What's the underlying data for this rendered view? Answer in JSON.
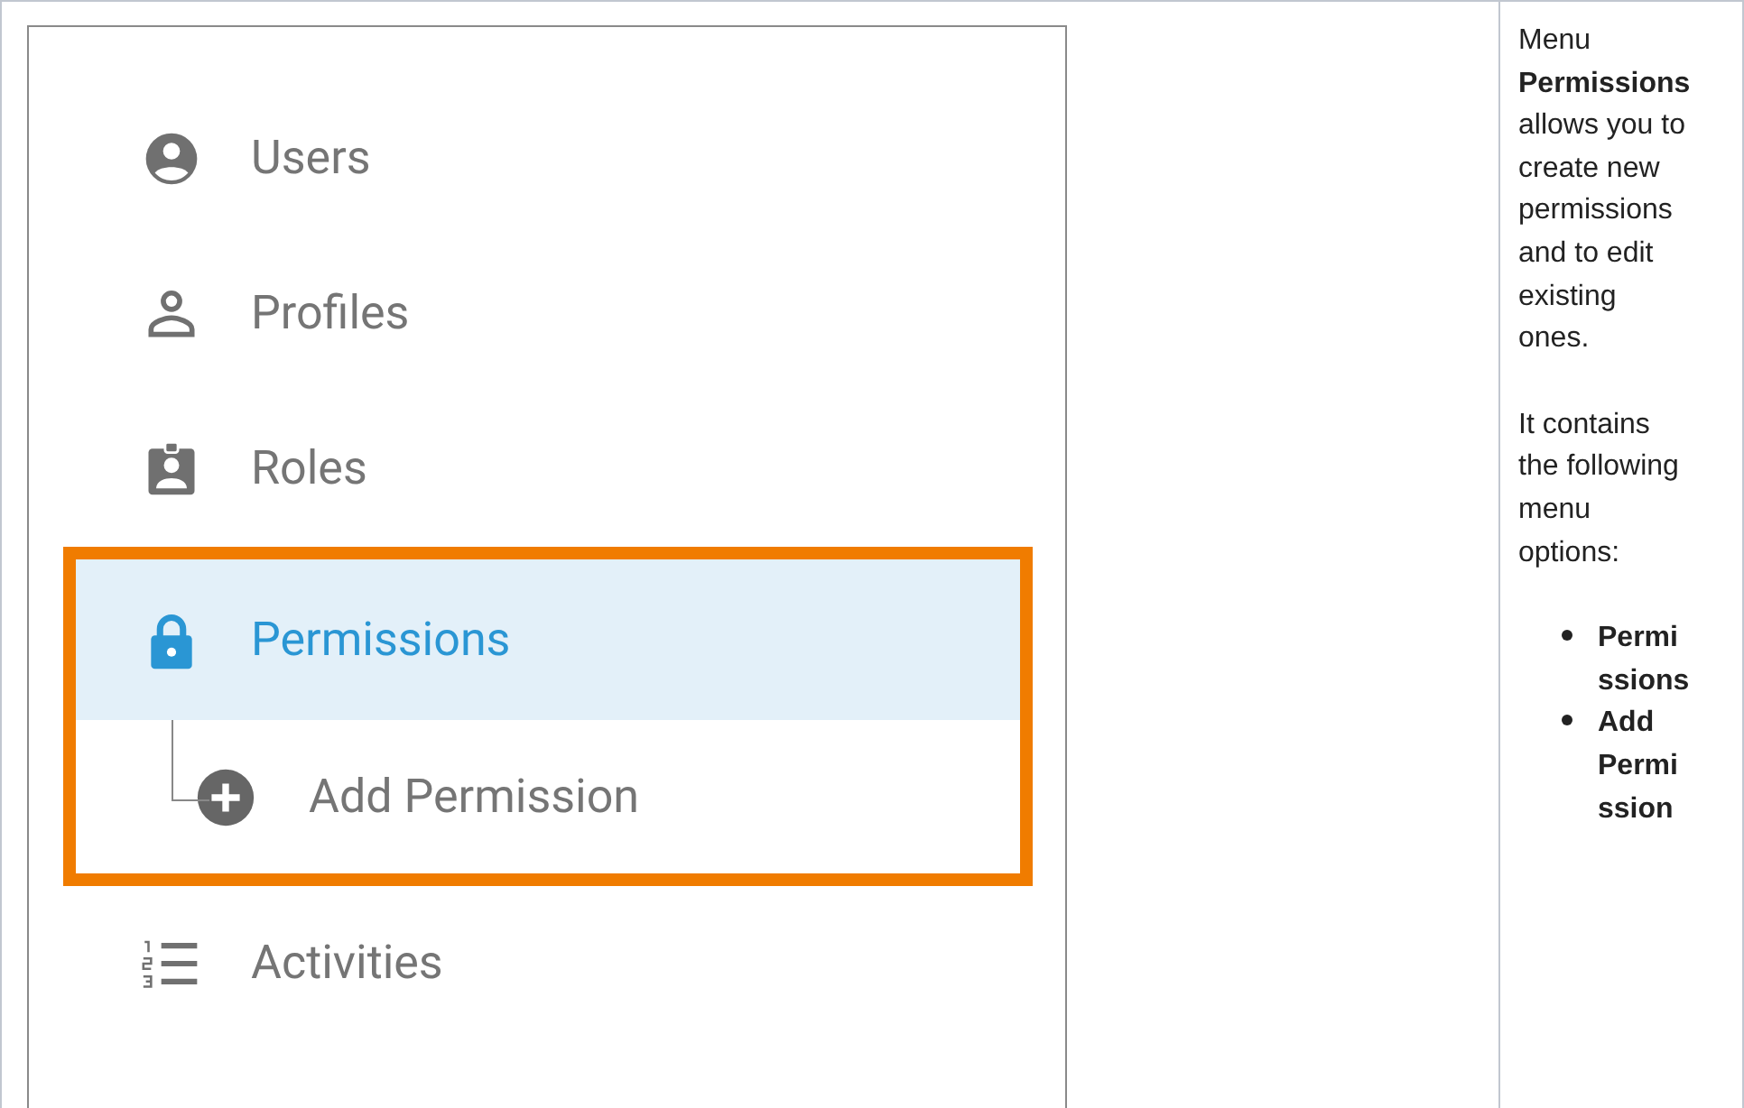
{
  "menu": {
    "items": [
      {
        "label": "Users",
        "kind": "user-circle",
        "selected": false,
        "highlighted": false
      },
      {
        "label": "Profiles",
        "kind": "person-outline",
        "selected": false,
        "highlighted": false
      },
      {
        "label": "Roles",
        "kind": "badge",
        "selected": false,
        "highlighted": false
      },
      {
        "label": "Permissions",
        "kind": "lock",
        "selected": true,
        "highlighted": true,
        "children": [
          {
            "label": "Add Permission",
            "kind": "plus-circle",
            "selected": false,
            "highlighted": false
          }
        ]
      },
      {
        "label": "Activities",
        "kind": "numbered-list",
        "selected": false,
        "highlighted": false
      }
    ]
  },
  "description": {
    "paragraphs": [
      "Menu **Permissions** allows you to create new permissions and to edit existing ones.",
      "It contains the following menu options:"
    ],
    "options": [
      "Permissions",
      "Add Permission"
    ]
  }
}
